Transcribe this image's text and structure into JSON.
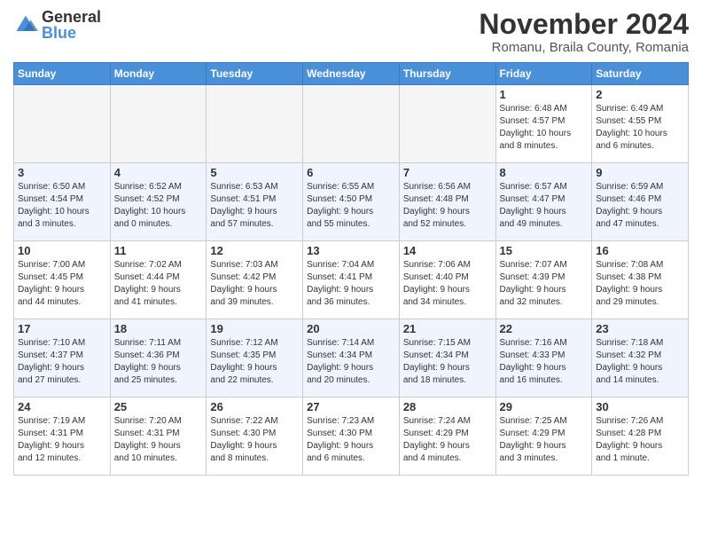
{
  "logo": {
    "general": "General",
    "blue": "Blue"
  },
  "title": "November 2024",
  "subtitle": "Romanu, Braila County, Romania",
  "headers": [
    "Sunday",
    "Monday",
    "Tuesday",
    "Wednesday",
    "Thursday",
    "Friday",
    "Saturday"
  ],
  "days": [
    {
      "num": "",
      "info": "",
      "empty": true
    },
    {
      "num": "",
      "info": "",
      "empty": true
    },
    {
      "num": "",
      "info": "",
      "empty": true
    },
    {
      "num": "",
      "info": "",
      "empty": true
    },
    {
      "num": "",
      "info": "",
      "empty": true
    },
    {
      "num": "1",
      "info": "Sunrise: 6:48 AM\nSunset: 4:57 PM\nDaylight: 10 hours\nand 8 minutes.",
      "empty": false
    },
    {
      "num": "2",
      "info": "Sunrise: 6:49 AM\nSunset: 4:55 PM\nDaylight: 10 hours\nand 6 minutes.",
      "empty": false
    },
    {
      "num": "3",
      "info": "Sunrise: 6:50 AM\nSunset: 4:54 PM\nDaylight: 10 hours\nand 3 minutes.",
      "empty": false
    },
    {
      "num": "4",
      "info": "Sunrise: 6:52 AM\nSunset: 4:52 PM\nDaylight: 10 hours\nand 0 minutes.",
      "empty": false
    },
    {
      "num": "5",
      "info": "Sunrise: 6:53 AM\nSunset: 4:51 PM\nDaylight: 9 hours\nand 57 minutes.",
      "empty": false
    },
    {
      "num": "6",
      "info": "Sunrise: 6:55 AM\nSunset: 4:50 PM\nDaylight: 9 hours\nand 55 minutes.",
      "empty": false
    },
    {
      "num": "7",
      "info": "Sunrise: 6:56 AM\nSunset: 4:48 PM\nDaylight: 9 hours\nand 52 minutes.",
      "empty": false
    },
    {
      "num": "8",
      "info": "Sunrise: 6:57 AM\nSunset: 4:47 PM\nDaylight: 9 hours\nand 49 minutes.",
      "empty": false
    },
    {
      "num": "9",
      "info": "Sunrise: 6:59 AM\nSunset: 4:46 PM\nDaylight: 9 hours\nand 47 minutes.",
      "empty": false
    },
    {
      "num": "10",
      "info": "Sunrise: 7:00 AM\nSunset: 4:45 PM\nDaylight: 9 hours\nand 44 minutes.",
      "empty": false
    },
    {
      "num": "11",
      "info": "Sunrise: 7:02 AM\nSunset: 4:44 PM\nDaylight: 9 hours\nand 41 minutes.",
      "empty": false
    },
    {
      "num": "12",
      "info": "Sunrise: 7:03 AM\nSunset: 4:42 PM\nDaylight: 9 hours\nand 39 minutes.",
      "empty": false
    },
    {
      "num": "13",
      "info": "Sunrise: 7:04 AM\nSunset: 4:41 PM\nDaylight: 9 hours\nand 36 minutes.",
      "empty": false
    },
    {
      "num": "14",
      "info": "Sunrise: 7:06 AM\nSunset: 4:40 PM\nDaylight: 9 hours\nand 34 minutes.",
      "empty": false
    },
    {
      "num": "15",
      "info": "Sunrise: 7:07 AM\nSunset: 4:39 PM\nDaylight: 9 hours\nand 32 minutes.",
      "empty": false
    },
    {
      "num": "16",
      "info": "Sunrise: 7:08 AM\nSunset: 4:38 PM\nDaylight: 9 hours\nand 29 minutes.",
      "empty": false
    },
    {
      "num": "17",
      "info": "Sunrise: 7:10 AM\nSunset: 4:37 PM\nDaylight: 9 hours\nand 27 minutes.",
      "empty": false
    },
    {
      "num": "18",
      "info": "Sunrise: 7:11 AM\nSunset: 4:36 PM\nDaylight: 9 hours\nand 25 minutes.",
      "empty": false
    },
    {
      "num": "19",
      "info": "Sunrise: 7:12 AM\nSunset: 4:35 PM\nDaylight: 9 hours\nand 22 minutes.",
      "empty": false
    },
    {
      "num": "20",
      "info": "Sunrise: 7:14 AM\nSunset: 4:34 PM\nDaylight: 9 hours\nand 20 minutes.",
      "empty": false
    },
    {
      "num": "21",
      "info": "Sunrise: 7:15 AM\nSunset: 4:34 PM\nDaylight: 9 hours\nand 18 minutes.",
      "empty": false
    },
    {
      "num": "22",
      "info": "Sunrise: 7:16 AM\nSunset: 4:33 PM\nDaylight: 9 hours\nand 16 minutes.",
      "empty": false
    },
    {
      "num": "23",
      "info": "Sunrise: 7:18 AM\nSunset: 4:32 PM\nDaylight: 9 hours\nand 14 minutes.",
      "empty": false
    },
    {
      "num": "24",
      "info": "Sunrise: 7:19 AM\nSunset: 4:31 PM\nDaylight: 9 hours\nand 12 minutes.",
      "empty": false
    },
    {
      "num": "25",
      "info": "Sunrise: 7:20 AM\nSunset: 4:31 PM\nDaylight: 9 hours\nand 10 minutes.",
      "empty": false
    },
    {
      "num": "26",
      "info": "Sunrise: 7:22 AM\nSunset: 4:30 PM\nDaylight: 9 hours\nand 8 minutes.",
      "empty": false
    },
    {
      "num": "27",
      "info": "Sunrise: 7:23 AM\nSunset: 4:30 PM\nDaylight: 9 hours\nand 6 minutes.",
      "empty": false
    },
    {
      "num": "28",
      "info": "Sunrise: 7:24 AM\nSunset: 4:29 PM\nDaylight: 9 hours\nand 4 minutes.",
      "empty": false
    },
    {
      "num": "29",
      "info": "Sunrise: 7:25 AM\nSunset: 4:29 PM\nDaylight: 9 hours\nand 3 minutes.",
      "empty": false
    },
    {
      "num": "30",
      "info": "Sunrise: 7:26 AM\nSunset: 4:28 PM\nDaylight: 9 hours\nand 1 minute.",
      "empty": false
    }
  ]
}
